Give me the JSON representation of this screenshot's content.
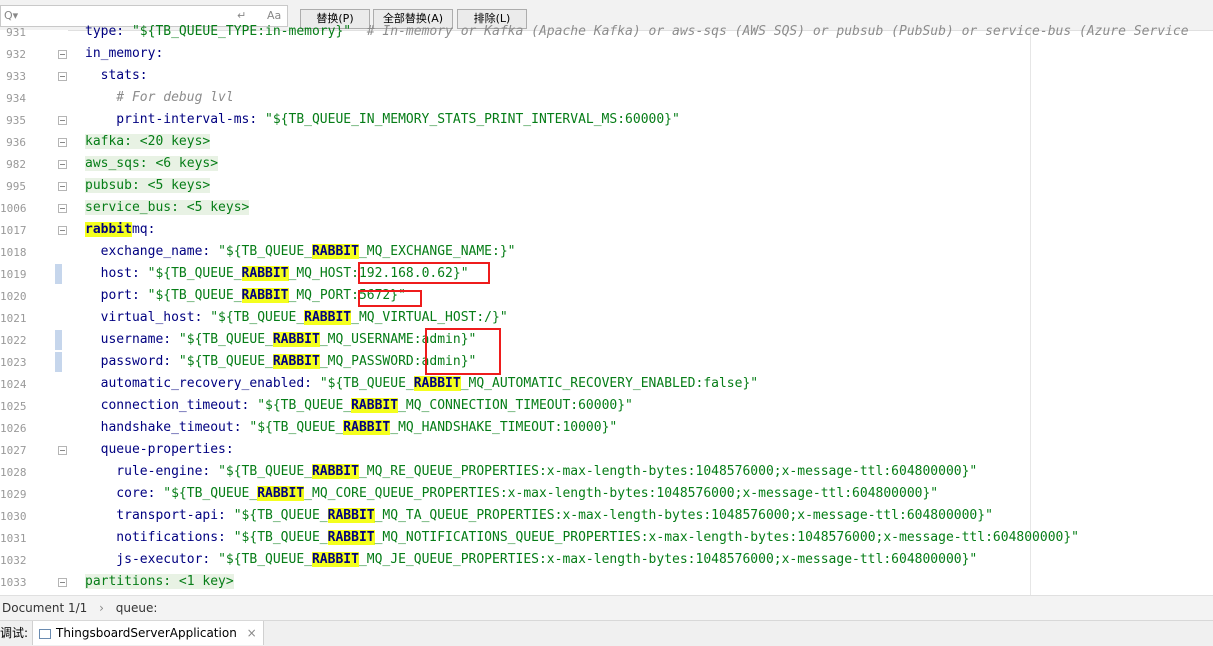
{
  "search_bar": {
    "regex_hint": "Q▾",
    "undo_icon": "↵",
    "case_icon": "Aa",
    "replace_label": "替换(P)",
    "replace_all_label": "全部替换(A)",
    "exclude_label": "排除(L)"
  },
  "lines": [
    {
      "no": "931",
      "parts": [
        {
          "t": "type: ",
          "c": "k"
        },
        {
          "t": "\"${TB_QUEUE_TYPE:in-memory}\"",
          "c": "s"
        },
        {
          "t": "  # In-memory or Kafka (Apache Kafka) or aws-sqs (AWS SQS) or pubsub (PubSub) or service-bus (Azure Service",
          "c": "c"
        }
      ]
    },
    {
      "no": "932",
      "parts": [
        {
          "t": "in_memory:",
          "c": "k"
        }
      ]
    },
    {
      "no": "933",
      "parts": [
        {
          "t": "  stats:",
          "c": "k"
        }
      ]
    },
    {
      "no": "934",
      "parts": [
        {
          "t": "    # For debug lvl",
          "c": "c"
        }
      ]
    },
    {
      "no": "935",
      "parts": [
        {
          "t": "    print-interval-ms: ",
          "c": "k"
        },
        {
          "t": "\"${TB_QUEUE_IN_MEMORY_STATS_PRINT_INTERVAL_MS:60000}\"",
          "c": "s"
        }
      ]
    },
    {
      "no": "936",
      "parts": [
        {
          "t": "kafka: <20 keys>",
          "c": "fold-hl"
        }
      ]
    },
    {
      "no": "982",
      "parts": [
        {
          "t": "aws_sqs: <6 keys>",
          "c": "fold-hl"
        }
      ]
    },
    {
      "no": "995",
      "parts": [
        {
          "t": "pubsub: <5 keys>",
          "c": "fold-hl"
        }
      ]
    },
    {
      "no": "1006",
      "parts": [
        {
          "t": "service_bus: <5 keys>",
          "c": "fold-hl"
        }
      ]
    },
    {
      "no": "1017",
      "parts": [
        {
          "t": "rabbit",
          "c": "hl"
        },
        {
          "t": "mq:",
          "c": "k"
        }
      ]
    },
    {
      "no": "1018",
      "parts": [
        {
          "t": "  exchange_name: ",
          "c": "k"
        },
        {
          "t": "\"${TB_QUEUE_",
          "c": "s"
        },
        {
          "t": "RABBIT",
          "c": "hl"
        },
        {
          "t": "_MQ_EXCHANGE_NAME:}\"",
          "c": "s"
        }
      ]
    },
    {
      "no": "1019",
      "parts": [
        {
          "t": "  host: ",
          "c": "k"
        },
        {
          "t": "\"${TB_QUEUE_",
          "c": "s"
        },
        {
          "t": "RABBIT",
          "c": "hl"
        },
        {
          "t": "_MQ_HOST:192.168.0.62}\"",
          "c": "s"
        }
      ]
    },
    {
      "no": "1020",
      "parts": [
        {
          "t": "  port: ",
          "c": "k"
        },
        {
          "t": "\"${TB_QUEUE_",
          "c": "s"
        },
        {
          "t": "RABBIT",
          "c": "hl"
        },
        {
          "t": "_MQ_PORT:5672}\"",
          "c": "s"
        }
      ]
    },
    {
      "no": "1021",
      "parts": [
        {
          "t": "  virtual_host: ",
          "c": "k"
        },
        {
          "t": "\"${TB_QUEUE_",
          "c": "s"
        },
        {
          "t": "RABBIT",
          "c": "hl"
        },
        {
          "t": "_MQ_VIRTUAL_HOST:/}\"",
          "c": "s"
        }
      ]
    },
    {
      "no": "1022",
      "parts": [
        {
          "t": "  username: ",
          "c": "k"
        },
        {
          "t": "\"${TB_QUEUE_",
          "c": "s"
        },
        {
          "t": "RABBIT",
          "c": "hl"
        },
        {
          "t": "_MQ_USERNAME:admin}\"",
          "c": "s"
        }
      ]
    },
    {
      "no": "1023",
      "parts": [
        {
          "t": "  password: ",
          "c": "k"
        },
        {
          "t": "\"${TB_QUEUE_",
          "c": "s"
        },
        {
          "t": "RABBIT",
          "c": "hl"
        },
        {
          "t": "_MQ_PASSWORD:admin}\"",
          "c": "s"
        }
      ]
    },
    {
      "no": "1024",
      "parts": [
        {
          "t": "  automatic_recovery_enabled: ",
          "c": "k"
        },
        {
          "t": "\"${TB_QUEUE_",
          "c": "s"
        },
        {
          "t": "RABBIT",
          "c": "hl"
        },
        {
          "t": "_MQ_AUTOMATIC_RECOVERY_ENABLED:false}\"",
          "c": "s"
        }
      ]
    },
    {
      "no": "1025",
      "parts": [
        {
          "t": "  connection_timeout: ",
          "c": "k"
        },
        {
          "t": "\"${TB_QUEUE_",
          "c": "s"
        },
        {
          "t": "RABBIT",
          "c": "hl"
        },
        {
          "t": "_MQ_CONNECTION_TIMEOUT:60000}\"",
          "c": "s"
        }
      ]
    },
    {
      "no": "1026",
      "parts": [
        {
          "t": "  handshake_timeout: ",
          "c": "k"
        },
        {
          "t": "\"${TB_QUEUE_",
          "c": "s"
        },
        {
          "t": "RABBIT",
          "c": "hl"
        },
        {
          "t": "_MQ_HANDSHAKE_TIMEOUT:10000}\"",
          "c": "s"
        }
      ]
    },
    {
      "no": "1027",
      "parts": [
        {
          "t": "  queue-properties:",
          "c": "k"
        }
      ]
    },
    {
      "no": "1028",
      "parts": [
        {
          "t": "    rule-engine: ",
          "c": "k"
        },
        {
          "t": "\"${TB_QUEUE_",
          "c": "s"
        },
        {
          "t": "RABBIT",
          "c": "hl"
        },
        {
          "t": "_MQ_RE_QUEUE_PROPERTIES:x-max-length-bytes:1048576000;x-message-ttl:604800000}\"",
          "c": "s"
        }
      ]
    },
    {
      "no": "1029",
      "parts": [
        {
          "t": "    core: ",
          "c": "k"
        },
        {
          "t": "\"${TB_QUEUE_",
          "c": "s"
        },
        {
          "t": "RABBIT",
          "c": "hl"
        },
        {
          "t": "_MQ_CORE_QUEUE_PROPERTIES:x-max-length-bytes:1048576000;x-message-ttl:604800000}\"",
          "c": "s"
        }
      ]
    },
    {
      "no": "1030",
      "parts": [
        {
          "t": "    transport-api: ",
          "c": "k"
        },
        {
          "t": "\"${TB_QUEUE_",
          "c": "s"
        },
        {
          "t": "RABBIT",
          "c": "hl"
        },
        {
          "t": "_MQ_TA_QUEUE_PROPERTIES:x-max-length-bytes:1048576000;x-message-ttl:604800000}\"",
          "c": "s"
        }
      ]
    },
    {
      "no": "1031",
      "parts": [
        {
          "t": "    notifications: ",
          "c": "k"
        },
        {
          "t": "\"${TB_QUEUE_",
          "c": "s"
        },
        {
          "t": "RABBIT",
          "c": "hl"
        },
        {
          "t": "_MQ_NOTIFICATIONS_QUEUE_PROPERTIES:x-max-length-bytes:1048576000;x-message-ttl:604800000}\"",
          "c": "s"
        }
      ]
    },
    {
      "no": "1032",
      "parts": [
        {
          "t": "    js-executor: ",
          "c": "k"
        },
        {
          "t": "\"${TB_QUEUE_",
          "c": "s"
        },
        {
          "t": "RABBIT",
          "c": "hl"
        },
        {
          "t": "_MQ_JE_QUEUE_PROPERTIES:x-max-length-bytes:1048576000;x-message-ttl:604800000}\"",
          "c": "s"
        }
      ]
    },
    {
      "no": "1033",
      "parts": [
        {
          "t": "partitions: <1 key>",
          "c": "fold-hl"
        }
      ]
    }
  ],
  "breadcrumb": {
    "document": "Document 1/1",
    "separator": "›",
    "path": "queue:"
  },
  "bottom_tabs": {
    "debug_label": "调试:",
    "run_config": "ThingsboardServerApplication",
    "close": "×"
  }
}
